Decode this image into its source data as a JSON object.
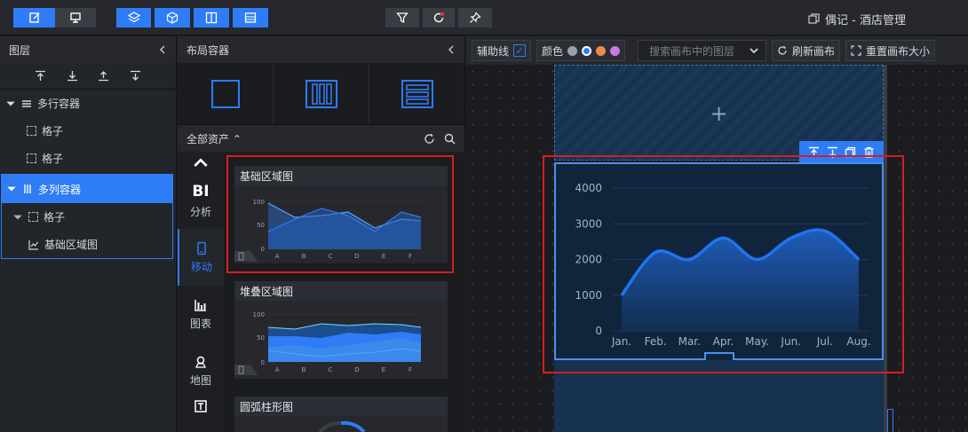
{
  "topbar": {
    "left_icons": [
      "edit-icon",
      "device-icon"
    ],
    "mid_icons": [
      "layers-icon",
      "cube-icon",
      "columns-icon",
      "rows-icon"
    ],
    "right_icons": [
      "filter-icon",
      "sync-icon",
      "pin-icon"
    ],
    "app_title": "偶记 - 酒店管理"
  },
  "layers": {
    "title": "图层",
    "items": [
      {
        "label": "多行容器"
      },
      {
        "label": "格子"
      },
      {
        "label": "格子"
      },
      {
        "label": "多列容器"
      },
      {
        "label": "格子"
      },
      {
        "label": "基础区域图"
      }
    ]
  },
  "container_panel": {
    "title": "布局容器",
    "assets_label": "全部资产",
    "categories": [
      {
        "big": "BI",
        "label": "分析"
      },
      {
        "label": "移动"
      },
      {
        "label": "图表"
      },
      {
        "label": "地图"
      }
    ],
    "assets": [
      {
        "title": "基础区域图",
        "x_labels": [
          "A",
          "B",
          "C",
          "D",
          "E",
          "F"
        ],
        "y_labels": [
          "100",
          "50",
          "0"
        ]
      },
      {
        "title": "堆叠区域图",
        "x_labels": [
          "A",
          "B",
          "C",
          "D",
          "E",
          "F"
        ],
        "y_labels": [
          "100",
          "50",
          "0"
        ]
      },
      {
        "title": "圆弧柱形图"
      }
    ]
  },
  "canvas_toolbar": {
    "guides_label": "辅助线",
    "color_label": "颜色",
    "colors": [
      "#9aa0a8",
      "#2e7cf6",
      "#f08a4b",
      "#c77be0"
    ],
    "search_placeholder": "搜索画布中的图层",
    "refresh_label": "刷新画布",
    "reset_label": "重置画布大小"
  },
  "chart_data": {
    "type": "area",
    "categories": [
      "Jan.",
      "Feb.",
      "Mar.",
      "Apr.",
      "May.",
      "Jun.",
      "Jul.",
      "Aug."
    ],
    "values": [
      1000,
      2200,
      2000,
      2600,
      2000,
      2600,
      2800,
      2000
    ],
    "yticks": [
      "4000",
      "3000",
      "2000",
      "1000",
      "0"
    ],
    "ylim": [
      0,
      4000
    ],
    "line_color": "#1f74f2",
    "fill_color": "#1f5fbf"
  }
}
